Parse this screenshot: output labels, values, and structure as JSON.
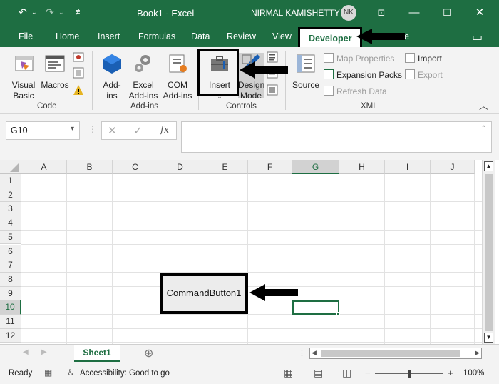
{
  "titlebar": {
    "book": "Book1  -  Excel",
    "user": "NIRMAL KAMISHETTY",
    "avatar": "NK",
    "bg_color": "#1e6e42"
  },
  "tabs": [
    {
      "label": "File"
    },
    {
      "label": "Home"
    },
    {
      "label": "Insert"
    },
    {
      "label": "Formulas"
    },
    {
      "label": "Data"
    },
    {
      "label": "Review"
    },
    {
      "label": "View"
    },
    {
      "label": "Developer",
      "active": true
    },
    {
      "label": "e"
    }
  ],
  "ribbon": {
    "code": {
      "label": "Code",
      "visual_basic": "Visual Basic",
      "macros": "Macros"
    },
    "addins": {
      "label": "Add-ins",
      "addins": "Add-ins",
      "excel_addins": "Excel Add-ins",
      "com_addins": "COM Add-ins"
    },
    "controls": {
      "label": "Controls",
      "insert": "Insert",
      "design_mode": "Design Mode"
    },
    "xml": {
      "label": "XML",
      "source": "Source",
      "map_properties": "Map Properties",
      "expansion_packs": "Expansion Packs",
      "refresh_data": "Refresh Data",
      "import": "Import",
      "export": "Export"
    }
  },
  "formula_bar": {
    "name_box": "G10",
    "fx": "fx",
    "formula": ""
  },
  "grid": {
    "columns": [
      "A",
      "B",
      "C",
      "D",
      "E",
      "F",
      "G",
      "H",
      "I",
      "J"
    ],
    "rows": [
      "1",
      "2",
      "3",
      "4",
      "5",
      "6",
      "7",
      "8",
      "9",
      "10",
      "11",
      "12"
    ],
    "selected_column": "G",
    "selected_row": "10"
  },
  "command_button": {
    "label": "CommandButton1"
  },
  "sheet_tabs": [
    {
      "label": "Sheet1",
      "active": true
    }
  ],
  "status": {
    "ready": "Ready",
    "accessibility": "Accessibility: Good to go",
    "zoom": "100%"
  }
}
